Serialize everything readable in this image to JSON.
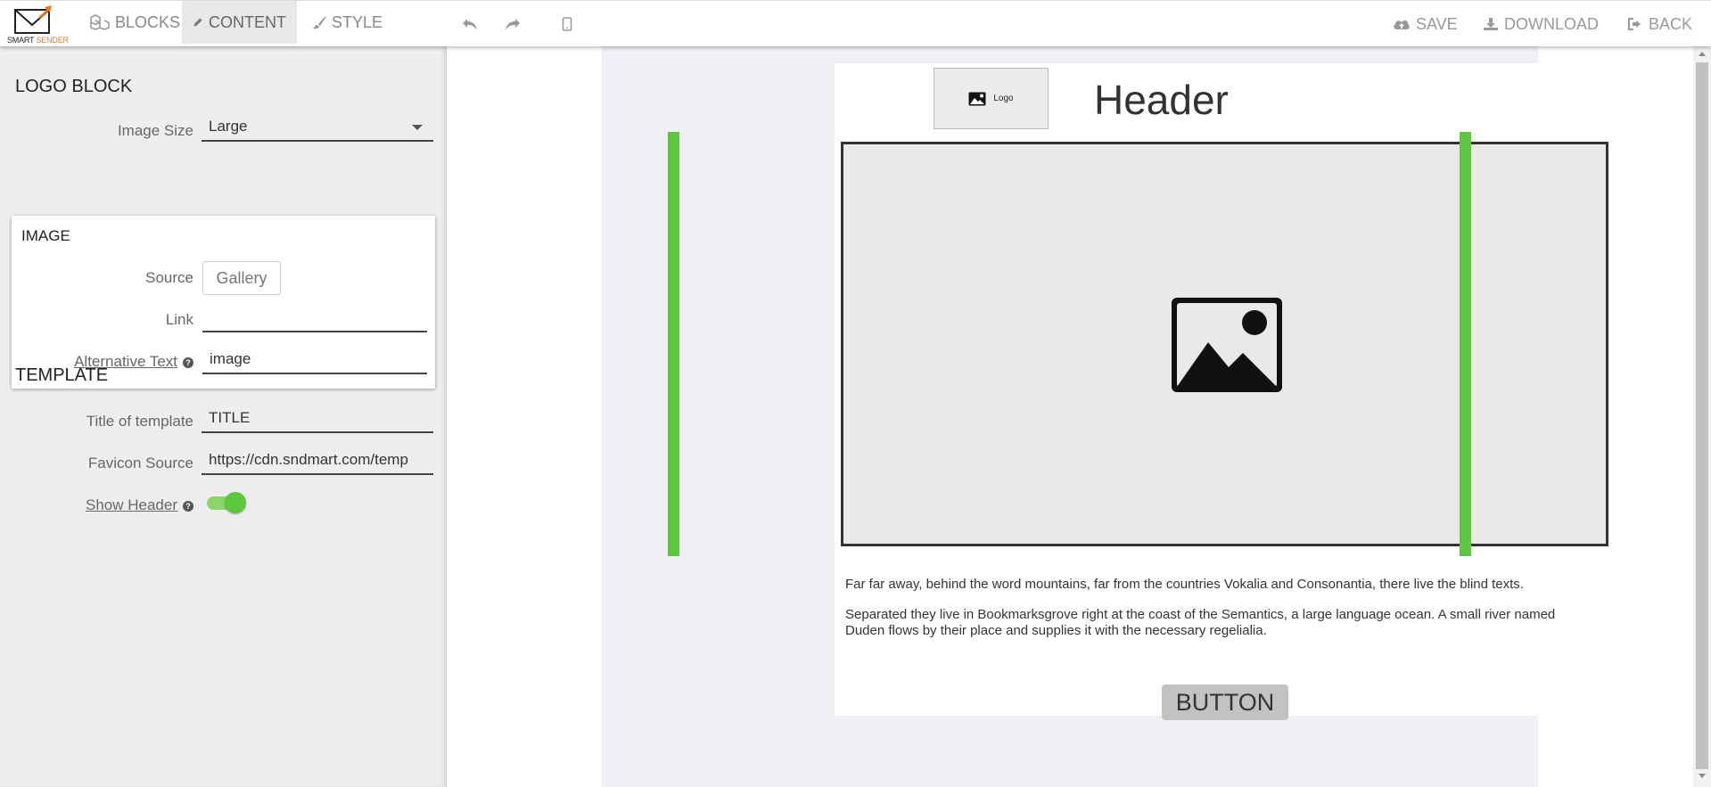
{
  "brand": {
    "word1": "SMART",
    "word2": "SENDER",
    "icon": "envelope-icon"
  },
  "toolbar": {
    "tabs": [
      {
        "label": "BLOCKS",
        "icon": "blocks-icon"
      },
      {
        "label": "CONTENT",
        "icon": "pencil-icon",
        "active": true
      },
      {
        "label": "STYLE",
        "icon": "brush-icon"
      }
    ],
    "tools": [
      "undo-icon",
      "redo-icon",
      "mobile-preview-icon"
    ],
    "actions": [
      {
        "label": "SAVE",
        "icon": "cloud-upload-icon"
      },
      {
        "label": "DOWNLOAD",
        "icon": "download-icon"
      },
      {
        "label": "BACK",
        "icon": "sign-out-icon"
      }
    ]
  },
  "panel": {
    "logo_block": {
      "title": "LOGO BLOCK",
      "image_size_label": "Image Size",
      "image_size_value": "Large"
    },
    "image": {
      "title": "IMAGE",
      "source_label": "Source",
      "source_button": "Gallery",
      "link_label": "Link",
      "link_value": "",
      "alt_label": "Alternative Text",
      "alt_value": "image"
    },
    "template": {
      "title": "TEMPLATE",
      "title_label": "Title of template",
      "title_value": "TITLE",
      "favicon_label": "Favicon Source",
      "favicon_value": "https://cdn.sndmart.com/temp",
      "show_header_label": "Show Header",
      "show_header_on": true
    }
  },
  "email": {
    "logo_text": "Logo",
    "header": "Header",
    "paragraph1": "Far far away, behind the word mountains, far from the countries Vokalia and Consonantia, there live the blind texts.",
    "paragraph2": "Separated they live in Bookmarksgrove right at the coast of the Semantics, a large language ocean. A small river named Duden flows by their place and supplies it with the necessary regelialia.",
    "button": "BUTTON"
  },
  "colors": {
    "selection": "#5cc83a",
    "toggle": "#5ac83a",
    "brand_accent": "#f07a1a"
  }
}
